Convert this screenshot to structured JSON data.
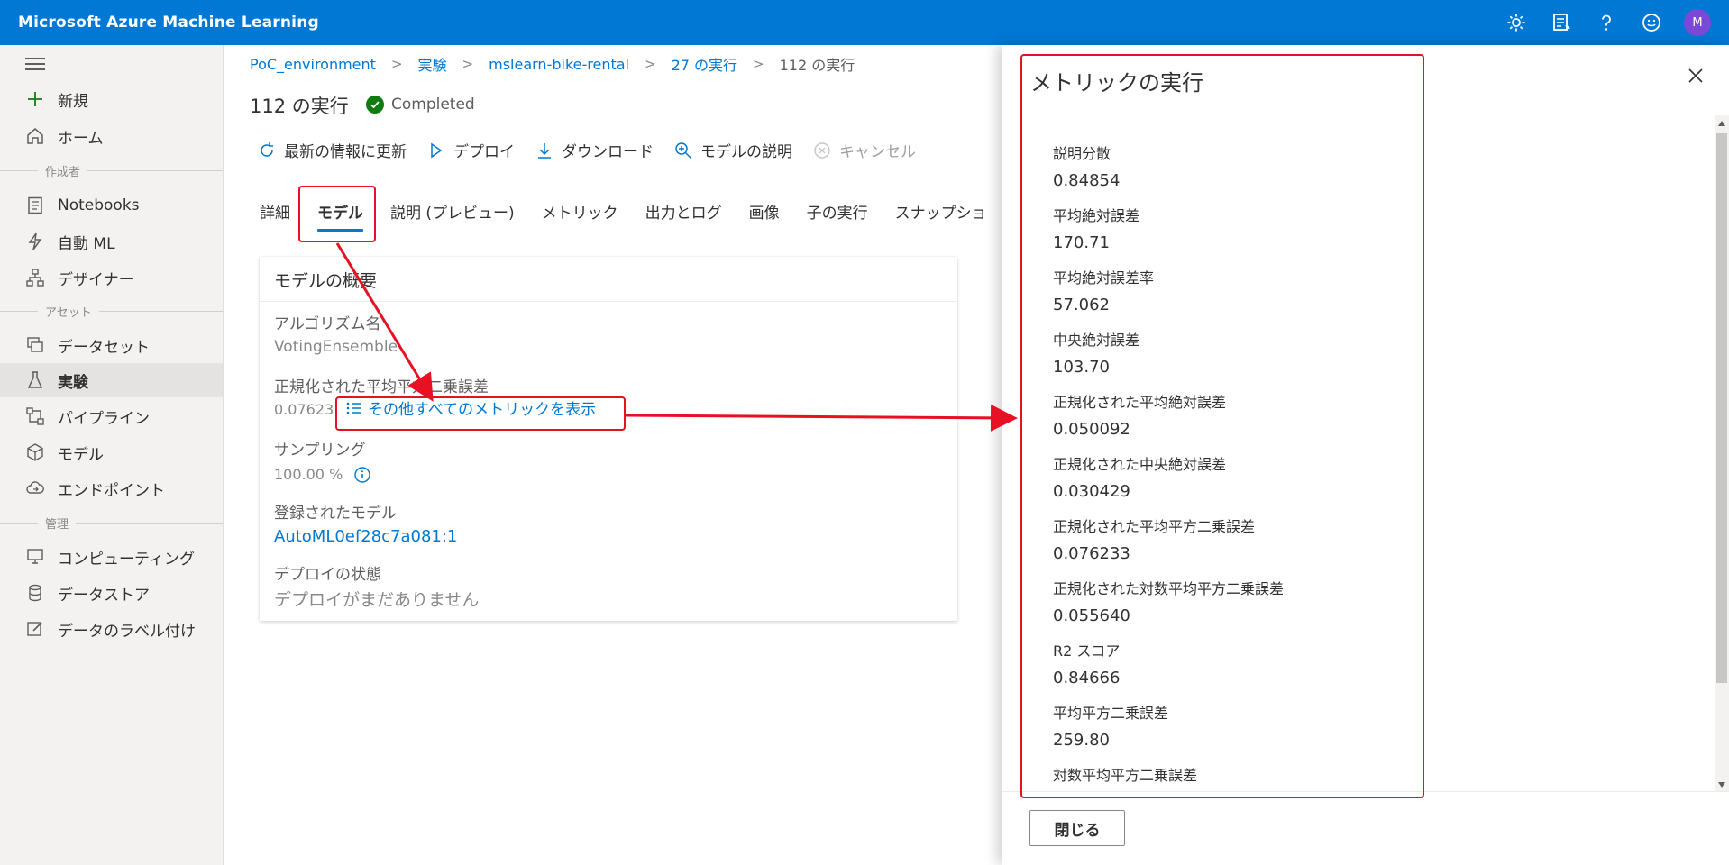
{
  "app": {
    "title": "Microsoft Azure Machine Learning",
    "avatar_initial": "M"
  },
  "topbar_icons": [
    "gear-icon",
    "feedback-icon",
    "help-icon",
    "smiley-icon",
    "account-avatar"
  ],
  "nav": {
    "new": "新規",
    "home": "ホーム",
    "section_author": "作成者",
    "notebooks": "Notebooks",
    "automl": "自動 ML",
    "designer": "デザイナー",
    "section_assets": "アセット",
    "datasets": "データセット",
    "experiments": "実験",
    "pipelines": "パイプライン",
    "models": "モデル",
    "endpoints": "エンドポイント",
    "section_manage": "管理",
    "compute": "コンピューティング",
    "datastores": "データストア",
    "labeling": "データのラベル付け"
  },
  "breadcrumb": {
    "workspace": "PoC_environment",
    "experiments": "実験",
    "experiment": "mslearn-bike-rental",
    "parent_run": "27 の実行",
    "current": "112 の実行"
  },
  "run": {
    "title": "112 の実行",
    "status": "Completed"
  },
  "toolbar": {
    "refresh": "最新の情報に更新",
    "deploy": "デプロイ",
    "download": "ダウンロード",
    "explain": "モデルの説明",
    "cancel": "キャンセル"
  },
  "tabs": {
    "details": "詳細",
    "model": "モデル",
    "explanations": "説明 (プレビュー)",
    "metrics": "メトリック",
    "outputs": "出力とログ",
    "images": "画像",
    "child_runs": "子の実行",
    "snapshot": "スナップショ"
  },
  "model_card": {
    "title": "モデルの概要",
    "algorithm_label": "アルゴリズム名",
    "algorithm_value": "VotingEnsemble",
    "metric_label": "正規化された平均平方二乗誤差",
    "metric_value": "0.07623",
    "all_metrics_link": "その他すべてのメトリックを表示",
    "sampling_label": "サンプリング",
    "sampling_value": "100.00 %",
    "registered_label": "登録されたモデル",
    "registered_value": "AutoML0ef28c7a081:1",
    "deploy_label": "デプロイの状態",
    "deploy_value": "デプロイがまだありません"
  },
  "panel": {
    "title": "メトリックの実行",
    "close_label": "閉じる",
    "metrics": [
      {
        "name": "説明分散",
        "value": "0.84854"
      },
      {
        "name": "平均絶対誤差",
        "value": "170.71"
      },
      {
        "name": "平均絶対誤差率",
        "value": "57.062"
      },
      {
        "name": "中央絶対誤差",
        "value": "103.70"
      },
      {
        "name": "正規化された平均絶対誤差",
        "value": "0.050092"
      },
      {
        "name": "正規化された中央絶対誤差",
        "value": "0.030429"
      },
      {
        "name": "正規化された平均平方二乗誤差",
        "value": "0.076233"
      },
      {
        "name": "正規化された対数平均平方二乗誤差",
        "value": "0.055640"
      },
      {
        "name": "R2 スコア",
        "value": "0.84666"
      },
      {
        "name": "平均平方二乗誤差",
        "value": "259.80"
      },
      {
        "name": "対数平均平方二乗誤差",
        "value": ""
      }
    ]
  },
  "colors": {
    "brand": "#0078d4",
    "success": "#107c10",
    "annotation": "#e81123"
  }
}
